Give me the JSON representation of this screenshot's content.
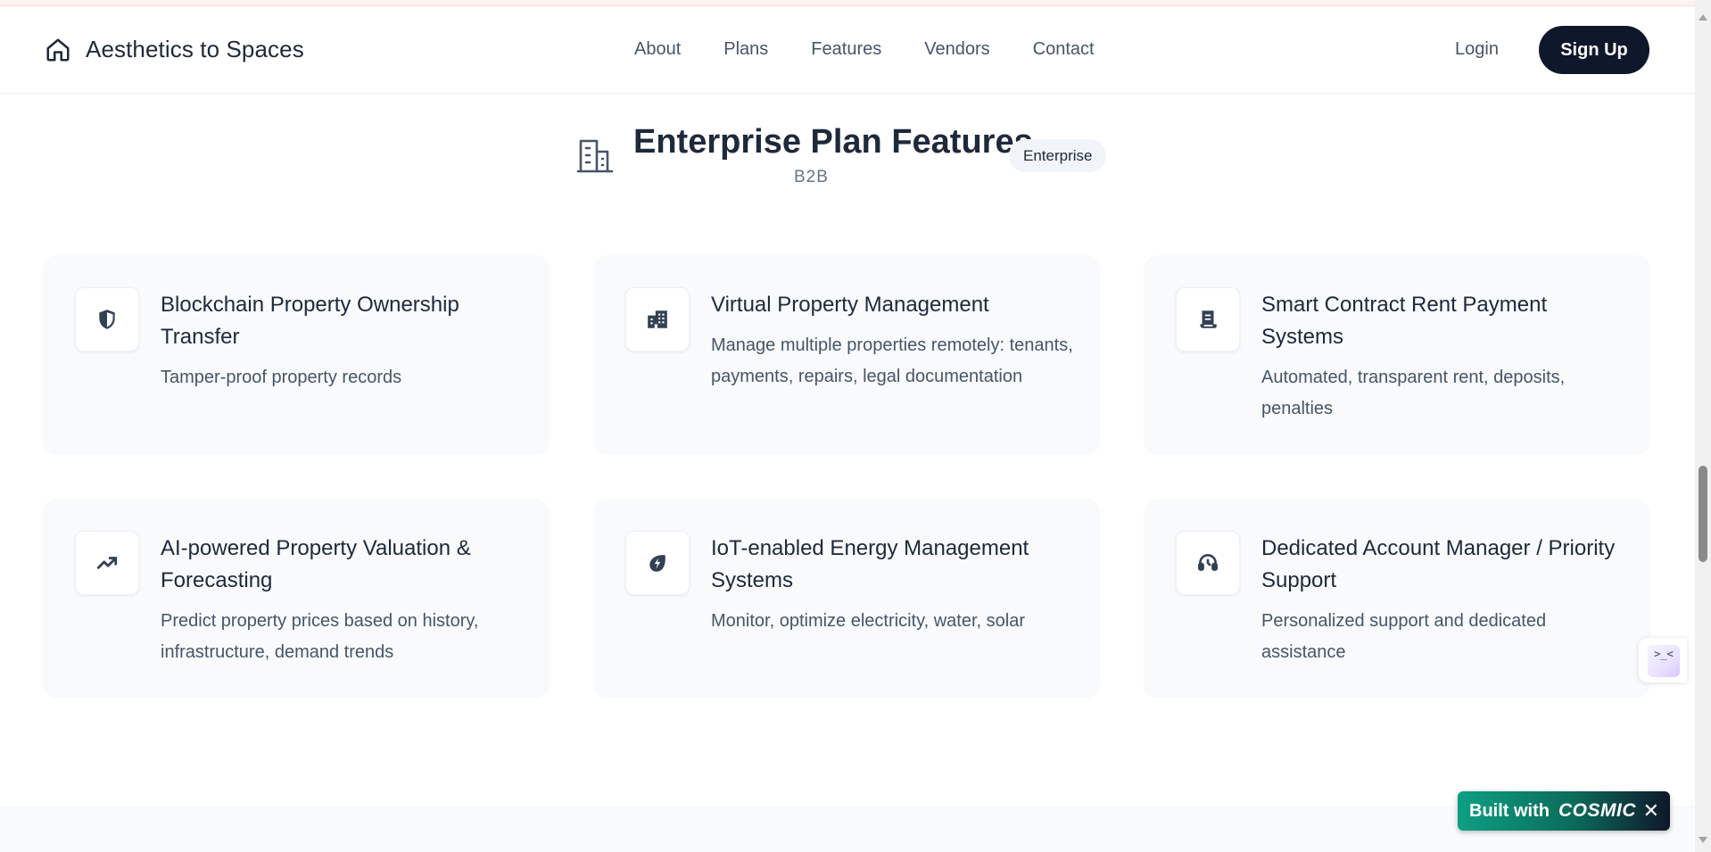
{
  "header": {
    "brand": "Aesthetics to Spaces",
    "nav": [
      "About",
      "Plans",
      "Features",
      "Vendors",
      "Contact"
    ],
    "login": "Login",
    "signup": "Sign Up"
  },
  "section": {
    "title": "Enterprise Plan Features",
    "subtitle": "B2B",
    "badge": "Enterprise"
  },
  "features": [
    {
      "title": "Blockchain Property Ownership Transfer",
      "desc": "Tamper-proof property records",
      "icon": "shield-icon"
    },
    {
      "title": "Virtual Property Management",
      "desc": "Manage multiple properties remotely: tenants, payments, repairs, legal documentation",
      "icon": "buildings-icon"
    },
    {
      "title": "Smart Contract Rent Payment Systems",
      "desc": "Automated, transparent rent, deposits, penalties",
      "icon": "receipt-icon"
    },
    {
      "title": "AI-powered Property Valuation & Forecasting",
      "desc": "Predict property prices based on history, infrastructure, demand trends",
      "icon": "trending-up-icon"
    },
    {
      "title": "IoT-enabled Energy Management Systems",
      "desc": "Monitor, optimize electricity, water, solar",
      "icon": "energy-leaf-icon"
    },
    {
      "title": "Dedicated Account Manager / Priority Support",
      "desc": "Personalized support and dedicated assistance",
      "icon": "headset-icon"
    }
  ],
  "widget": {
    "face": ">_<"
  },
  "cosmic": {
    "built_with": "Built with",
    "brand": "COSMIC",
    "close": "✕"
  },
  "colors": {
    "primary": "#0f172a",
    "card_bg": "#f8fafc",
    "text_muted": "#475569"
  }
}
